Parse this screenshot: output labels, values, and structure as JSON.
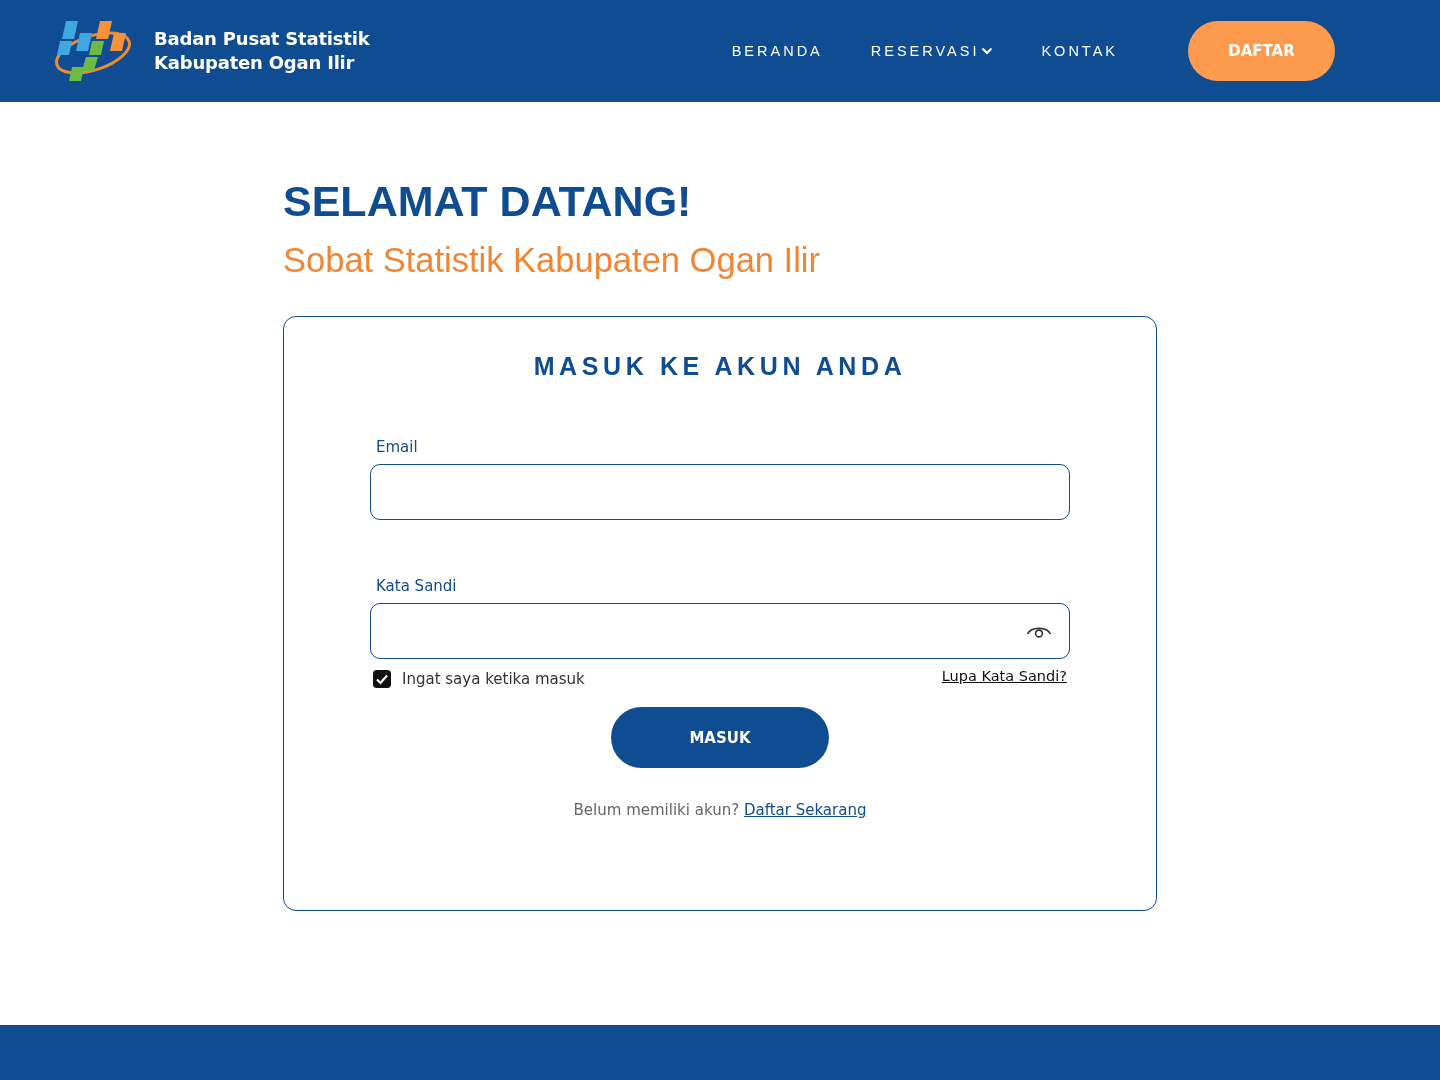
{
  "header": {
    "logo_title": "Badan Pusat Statistik",
    "logo_subtitle": "Kabupaten Ogan Ilir",
    "nav": [
      {
        "label": "BERANDA",
        "kind": "link"
      },
      {
        "label": "RESERVASI",
        "kind": "dropdown"
      },
      {
        "label": "KONTAK",
        "kind": "link"
      }
    ],
    "cta": "DAFTAR"
  },
  "welcome": {
    "title": "SELAMAT DATANG!",
    "subtitle": "Sobat Statistik Kabupaten Ogan Ilir"
  },
  "login": {
    "heading": "MASUK KE AKUN ANDA",
    "fields": [
      {
        "label": "Email",
        "kind": "text"
      },
      {
        "label": "Kata Sandi",
        "kind": "password"
      }
    ],
    "remember": {
      "label": "Ingat saya ketika masuk",
      "checked": true
    },
    "forgot": "Lupa Kata Sandi?",
    "submit": "MASUK",
    "signup_prompt": "Belum memiliki akun?",
    "signup_link": "Daftar Sekarang"
  }
}
